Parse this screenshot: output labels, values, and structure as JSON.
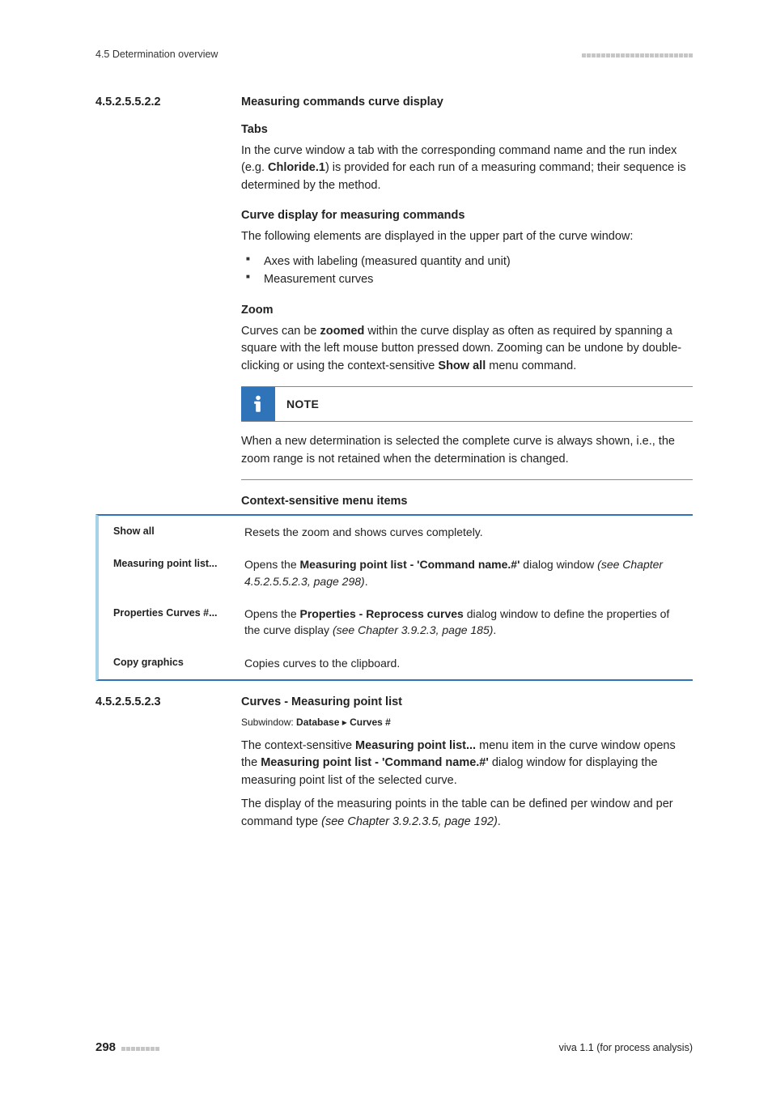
{
  "header": {
    "left": "4.5 Determination overview"
  },
  "sec1": {
    "num": "4.5.2.5.5.2.2",
    "title": "Measuring commands curve display",
    "tabs_h": "Tabs",
    "tabs_p_a": "In the curve window a tab with the corresponding command name and the run index (e.g. ",
    "tabs_p_b": "Chloride.1",
    "tabs_p_c": ") is provided for each run of a measuring command; their sequence is determined by the method.",
    "curve_h": "Curve display for measuring commands",
    "curve_p": "The following elements are displayed in the upper part of the curve window:",
    "li1": "Axes with labeling (measured quantity and unit)",
    "li2": "Measurement curves",
    "zoom_h": "Zoom",
    "zoom_a": "Curves can be ",
    "zoom_b": "zoomed",
    "zoom_c": " within the curve display as often as required by spanning a square with the left mouse button pressed down. Zooming can be undone by double-clicking or using the context-sensitive ",
    "zoom_d": "Show all",
    "zoom_e": " menu command.",
    "note_label": "NOTE",
    "note_body": "When a new determination is selected the complete curve is always shown, i.e., the zoom range is not retained when the determination is changed.",
    "ctx_h": "Context-sensitive menu items"
  },
  "ctx": {
    "r1": {
      "label": "Show all",
      "desc": "Resets the zoom and shows curves completely."
    },
    "r2": {
      "label": "Measuring point list...",
      "d_a": "Opens the ",
      "d_b": "Measuring point list - 'Command name.#'",
      "d_c": " dialog window ",
      "d_d": "(see Chapter 4.5.2.5.5.2.3, page 298)",
      "d_e": "."
    },
    "r3": {
      "label": "Properties Curves #...",
      "d_a": "Opens the ",
      "d_b": "Properties - Reprocess curves",
      "d_c": " dialog window to define the properties of the curve display ",
      "d_d": "(see Chapter 3.9.2.3, page 185)",
      "d_e": "."
    },
    "r4": {
      "label": "Copy graphics",
      "desc": "Copies curves to the clipboard."
    }
  },
  "sec2": {
    "num": "4.5.2.5.5.2.3",
    "title": "Curves - Measuring point list",
    "sw_a": "Subwindow: ",
    "sw_b": "Database",
    "sw_sep": " ▸ ",
    "sw_c": "Curves #",
    "p1_a": "The context-sensitive ",
    "p1_b": "Measuring point list...",
    "p1_c": " menu item in the curve window opens the ",
    "p1_d": "Measuring point list - 'Command name.#'",
    "p1_e": " dialog window for displaying the measuring point list of the selected curve.",
    "p2_a": "The display of the measuring points in the table can be defined per window and per command type ",
    "p2_b": "(see Chapter 3.9.2.3.5, page 192)",
    "p2_c": "."
  },
  "footer": {
    "page": "298",
    "right": "viva 1.1 (for process analysis)"
  }
}
